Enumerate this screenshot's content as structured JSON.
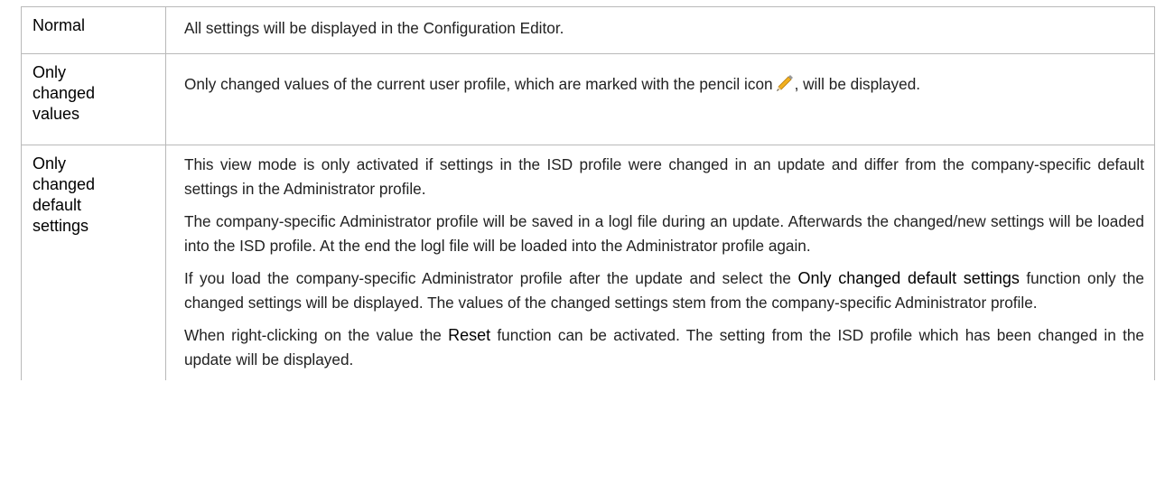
{
  "rows": [
    {
      "term": "Normal",
      "paragraphs": [
        "All settings will be displayed in the Configuration Editor."
      ]
    },
    {
      "term_lines": [
        "Only",
        "changed",
        "values"
      ],
      "text_before_icon": "Only changed values of the current user profile, which are marked with the pencil icon",
      "icon": "pencil-icon",
      "text_after_icon": ", will be displayed."
    },
    {
      "term_lines": [
        "Only",
        "changed",
        "default",
        "settings"
      ],
      "p1": "This view mode is only activated if settings in the ISD profile were changed in an update and differ from the company-specific default settings in the Administrator profile.",
      "p2": "The company-specific Administrator profile will be saved in a logl file during an update. Afterwards the changed/new settings will be loaded into the ISD profile. At the end the logl file will be loaded into the Administrator profile again.",
      "p3_before": "If you load the company-specific Administrator profile after the update and select the ",
      "p3_keyword": "Only changed default settings",
      "p3_after": " function only the changed settings will be displayed. The values of the changed settings stem from the company-specific Administrator profile.",
      "p4_before": "When right-clicking on the value the ",
      "p4_keyword": "Reset",
      "p4_after": " function can be activated. The setting from the ISD profile which has been changed in the update will be displayed."
    }
  ],
  "colors": {
    "border": "#b9b9b9",
    "text": "#222222",
    "pencil_body": "#f2b01e",
    "pencil_tip": "#4a4a4a"
  }
}
